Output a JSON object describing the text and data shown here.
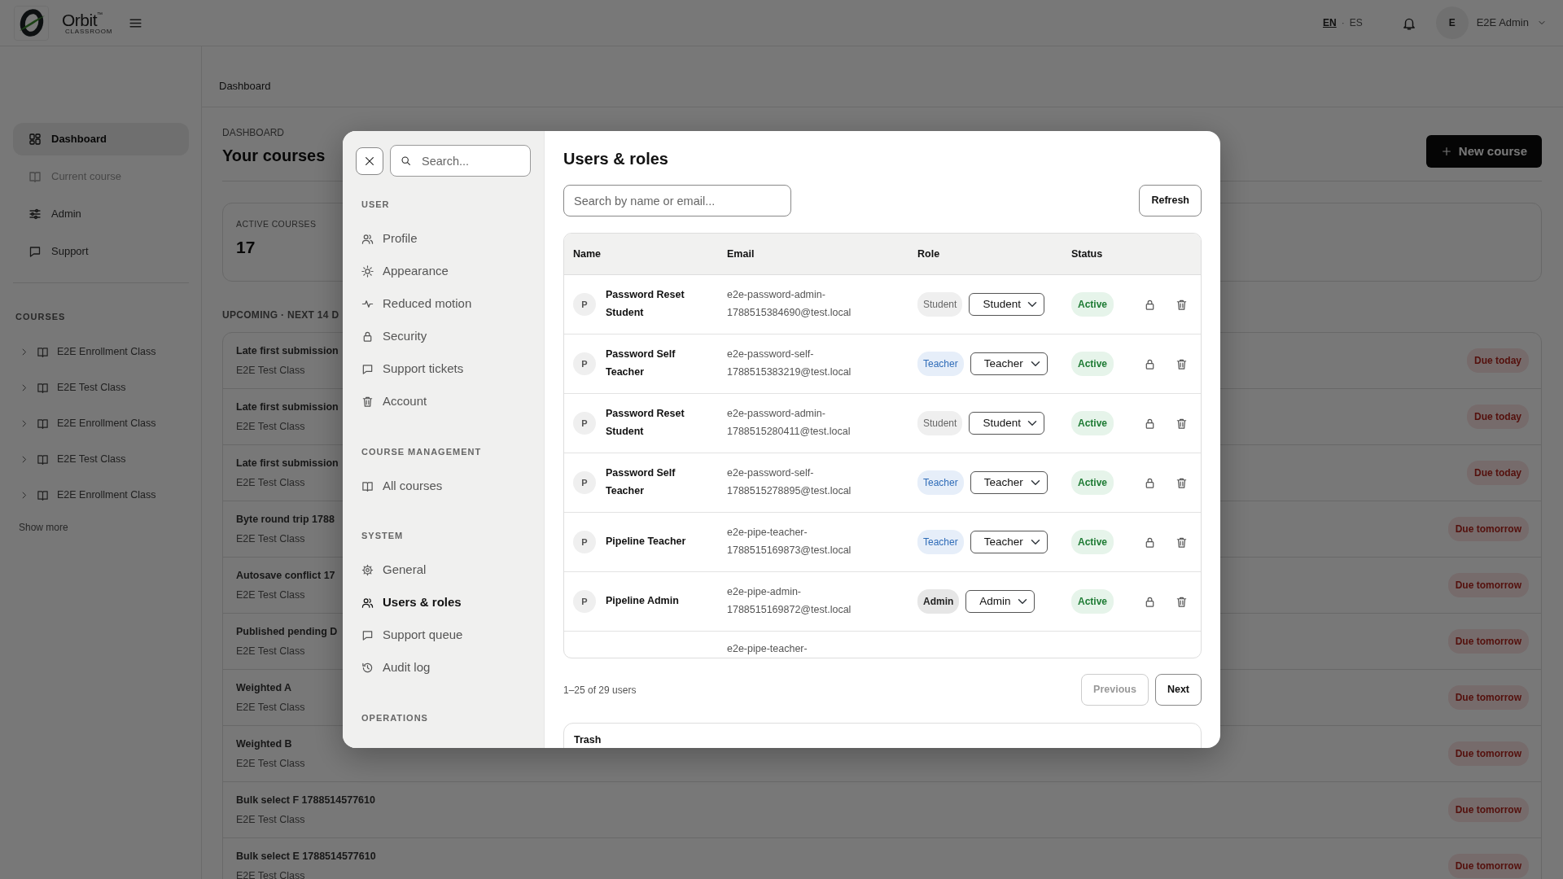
{
  "topbar": {
    "brand": "Orbit",
    "brand_sub": "CLASSROOM",
    "brand_mark": "™",
    "languages": [
      {
        "label": "EN",
        "selected": true
      },
      {
        "label": "ES",
        "selected": false
      }
    ],
    "language_separator": "·",
    "user": {
      "initial": "E",
      "name": "E2E Admin"
    }
  },
  "sidebar": {
    "nav": [
      {
        "label": "Dashboard",
        "selected": true,
        "disabled": false
      },
      {
        "label": "Current course",
        "selected": false,
        "disabled": true
      },
      {
        "label": "Admin",
        "selected": false,
        "disabled": false
      },
      {
        "label": "Support",
        "selected": false,
        "disabled": false
      }
    ],
    "courses_heading": "COURSES",
    "courses": [
      {
        "label": "E2E Enrollment Class",
        "expanded": false
      },
      {
        "label": "E2E Test Class",
        "expanded": false
      },
      {
        "label": "E2E Enrollment Class",
        "expanded": false
      },
      {
        "label": "E2E Test Class",
        "expanded": false
      },
      {
        "label": "E2E Enrollment Class",
        "expanded": false
      }
    ],
    "show_more": "Show more"
  },
  "breadcrumb": "Dashboard",
  "main": {
    "eyebrow": "DASHBOARD",
    "title": "Your courses",
    "new_course_button": "New course",
    "stat": {
      "label": "ACTIVE COURSES",
      "value": "17"
    },
    "upcoming_heading": "UPCOMING · NEXT 14 D",
    "upcoming": [
      {
        "title": "Late first submission",
        "course": "E2E Test Class",
        "due": "Due today"
      },
      {
        "title": "Late first submission",
        "course": "E2E Test Class",
        "due": "Due today"
      },
      {
        "title": "Late first submission",
        "course": "E2E Test Class",
        "due": "Due today"
      },
      {
        "title": "Byte round trip 1788",
        "course": "E2E Test Class",
        "due": "Due tomorrow"
      },
      {
        "title": "Autosave conflict 17",
        "course": "E2E Test Class",
        "due": "Due tomorrow"
      },
      {
        "title": "Published pending D",
        "course": "E2E Test Class",
        "due": "Due tomorrow"
      },
      {
        "title": "Weighted A",
        "course": "E2E Test Class",
        "due": "Due tomorrow"
      },
      {
        "title": "Weighted B",
        "course": "E2E Test Class",
        "due": "Due tomorrow"
      },
      {
        "title": "Bulk select F 1788514577610",
        "course": "E2E Test Class",
        "due": "Due tomorrow"
      },
      {
        "title": "Bulk select E 1788514577610",
        "course": "E2E Test Class",
        "due": "Due tomorrow"
      }
    ]
  },
  "modal": {
    "search_placeholder": "Search...",
    "sections": [
      {
        "heading": "USER",
        "items": [
          {
            "label": "Profile",
            "selected": false
          },
          {
            "label": "Appearance",
            "selected": false
          },
          {
            "label": "Reduced motion",
            "selected": false
          },
          {
            "label": "Security",
            "selected": false
          },
          {
            "label": "Support tickets",
            "selected": false
          },
          {
            "label": "Account",
            "selected": false
          }
        ]
      },
      {
        "heading": "COURSE MANAGEMENT",
        "items": [
          {
            "label": "All courses",
            "selected": false
          }
        ]
      },
      {
        "heading": "SYSTEM",
        "items": [
          {
            "label": "General",
            "selected": false
          },
          {
            "label": "Users & roles",
            "selected": true
          },
          {
            "label": "Support queue",
            "selected": false
          },
          {
            "label": "Audit log",
            "selected": false
          }
        ]
      },
      {
        "heading": "OPERATIONS"
      }
    ],
    "title": "Users & roles",
    "user_search_placeholder": "Search by name or email...",
    "refresh": "Refresh",
    "table": {
      "columns": [
        "Name",
        "Email",
        "Role",
        "Status"
      ],
      "rows": [
        {
          "initial": "P",
          "name": "Password Reset Student",
          "email": "e2e-password-admin-1788515384690@test.local",
          "role": {
            "label": "Student",
            "kind": "student"
          },
          "role_select": "Student",
          "status": "Active"
        },
        {
          "initial": "P",
          "name": "Password Self Teacher",
          "email": "e2e-password-self-1788515383219@test.local",
          "role": {
            "label": "Teacher",
            "kind": "teacher"
          },
          "role_select": "Teacher",
          "status": "Active"
        },
        {
          "initial": "P",
          "name": "Password Reset Student",
          "email": "e2e-password-admin-1788515280411@test.local",
          "role": {
            "label": "Student",
            "kind": "student"
          },
          "role_select": "Student",
          "status": "Active"
        },
        {
          "initial": "P",
          "name": "Password Self Teacher",
          "email": "e2e-password-self-1788515278895@test.local",
          "role": {
            "label": "Teacher",
            "kind": "teacher"
          },
          "role_select": "Teacher",
          "status": "Active"
        },
        {
          "initial": "P",
          "name": "Pipeline Teacher",
          "email": "e2e-pipe-teacher-1788515169873@test.local",
          "role": {
            "label": "Teacher",
            "kind": "teacher"
          },
          "role_select": "Teacher",
          "status": "Active"
        },
        {
          "initial": "P",
          "name": "Pipeline Admin",
          "email": "e2e-pipe-admin-1788515169872@test.local",
          "role": {
            "label": "Admin",
            "kind": "admin"
          },
          "role_select": "Admin",
          "status": "Active"
        },
        {
          "email": "e2e-pipe-teacher-"
        }
      ]
    },
    "pagination": {
      "summary": "1–25 of 29 users",
      "previous": {
        "label": "Previous",
        "disabled": true
      },
      "next": {
        "label": "Next",
        "disabled": false
      }
    },
    "trash": {
      "title": "Trash"
    }
  }
}
